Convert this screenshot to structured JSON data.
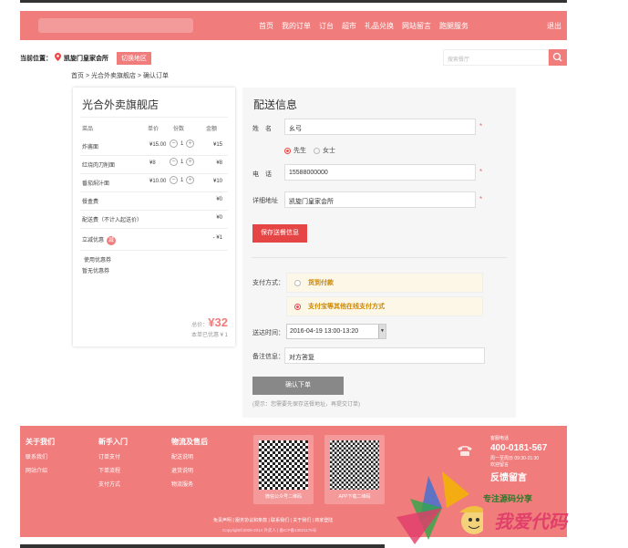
{
  "nav": {
    "links": [
      "首页",
      "我的订单",
      "订台",
      "超市",
      "礼品兑换",
      "网站留言",
      "跑腿服务"
    ],
    "exit": "退出"
  },
  "location": {
    "label": "当前位置：",
    "place": "凯旋门皇家会所",
    "switch": "切换地区",
    "search_placeholder": "搜索餐厅"
  },
  "breadcrumb": "首页 > 光合外卖旗舰店 > 确认订单",
  "shop": {
    "name": "光合外卖旗舰店",
    "headers": {
      "item": "菜品",
      "price": "单价",
      "qty": "份数",
      "amount": "金额"
    },
    "items": [
      {
        "name": "炸酱面",
        "price": "¥15.00",
        "qty": "1",
        "amount": "¥15"
      },
      {
        "name": "红烧肉刀削面",
        "price": "¥8",
        "qty": "1",
        "amount": "¥8"
      },
      {
        "name": "番茄焖汁面",
        "price": "¥10.00",
        "qty": "1",
        "amount": "¥10"
      }
    ],
    "box_fee": {
      "name": "餐盒费",
      "amount": "¥0"
    },
    "delivery_fee": {
      "name": "配送费（不计入起送价）",
      "amount": "¥0"
    },
    "discount": {
      "name": "立减优惠",
      "badge": "减",
      "amount": "- ¥1"
    },
    "use_coupon": "使用优惠券",
    "no_coupon": "暂无优惠券",
    "total_label": "总价：",
    "total": "¥32",
    "saved": "本单已优惠 ¥ 1"
  },
  "form": {
    "title": "配送信息",
    "name_label": "姓　名",
    "name_value": "幺弓",
    "gender_male": "先生",
    "gender_female": "女士",
    "phone_label": "电　话",
    "phone_value": "15588000000",
    "address_label": "详细地址",
    "address_value": "凯旋门皇家会所",
    "required": "*",
    "save_button": "保存送餐信息",
    "pay_label": "支付方式：",
    "pay_cash": "货到付款",
    "pay_online": "支付宝等其他在线支付方式",
    "time_label": "送达时间：",
    "time_value": "2016-04-19 13:00-13:20",
    "note_label": "备注信息：",
    "note_value": "对方答复",
    "confirm_button": "确认下单",
    "tip": "(提示：您需要先保存送餐地址，再提交订单)"
  },
  "footer": {
    "col1": {
      "title": "关于我们",
      "items": [
        "联系我们",
        "网站介绍"
      ]
    },
    "col2": {
      "title": "新手入门",
      "items": [
        "订单支付",
        "下单流程",
        "支付方式"
      ]
    },
    "col3": {
      "title": "物流及售后",
      "items": [
        "配送说明",
        "退货说明",
        "物流服务"
      ]
    },
    "qr1": "微信公众号二维码",
    "qr2": "APP下载二维码",
    "contact_label": "客服电话",
    "tel": "400-0181-567",
    "hours": "周一至周日 09:30-21:30",
    "feedback_label": "欢迎留言",
    "feedback": "反馈留言",
    "links": "免责声明 | 服务协议和条款 | 联系我们 | 关于我们 | 商家登陆",
    "copyright": "Copyright©2009-2014 外卖人 | 备ICP备13021175号"
  },
  "watermark": {
    "line1": "专注源码分享",
    "line2": "我爱代码"
  }
}
